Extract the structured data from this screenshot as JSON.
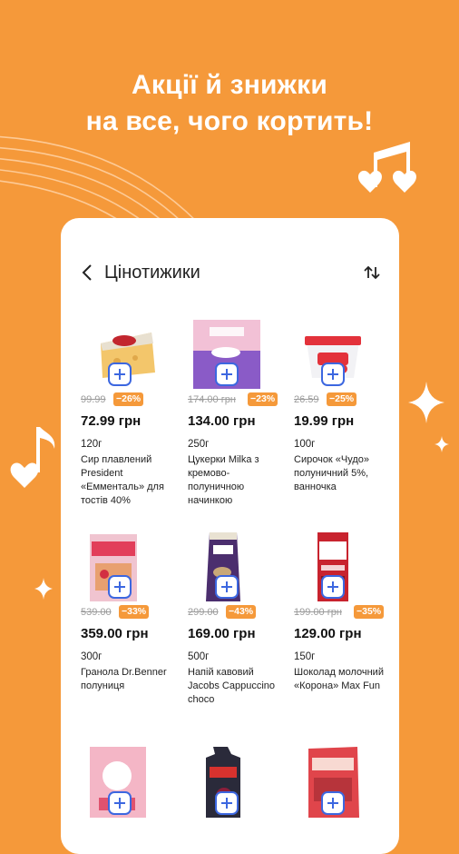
{
  "headline": {
    "line1": "Акції й знижки",
    "line2": "на все, чого кортить!"
  },
  "screen": {
    "title": "Цінотижики",
    "back_icon": "chevron-left-icon",
    "sort_icon": "sort-arrows-icon"
  },
  "colors": {
    "background": "#F5993A",
    "discount_badge": "#F5993A",
    "add_button": "#3C67E0"
  },
  "products": [
    {
      "old_price": "99.99",
      "discount": "−26%",
      "price": "72.99 грн",
      "weight": "120г",
      "name": "Сир плавлений President «Емменталь» для тостів 40%"
    },
    {
      "old_price": "174.00 грн",
      "discount": "−23%",
      "price": "134.00 грн",
      "weight": "250г",
      "name": "Цукерки Milka з кремово-полуничною начинкою"
    },
    {
      "old_price": "26.59",
      "discount": "−25%",
      "price": "19.99 грн",
      "weight": "100г",
      "name": "Сирочок «Чудо» полуничний 5%, ванночка"
    },
    {
      "old_price": "539.00",
      "discount": "−33%",
      "price": "359.00 грн",
      "weight": "300г",
      "name": "Гранола Dr.Benner полуниця"
    },
    {
      "old_price": "299.00",
      "discount": "−43%",
      "price": "169.00 грн",
      "weight": "500г",
      "name": "Напій кавовий Jacobs Cappuccino choco"
    },
    {
      "old_price": "199.00 грн",
      "discount": "−35%",
      "price": "129.00 грн",
      "weight": "150г",
      "name": "Шоколад молочний «Корона» Max Fun"
    },
    {
      "old_price": "",
      "discount": "",
      "price": "",
      "weight": "",
      "name": ""
    },
    {
      "old_price": "",
      "discount": "",
      "price": "",
      "weight": "",
      "name": ""
    },
    {
      "old_price": "",
      "discount": "",
      "price": "",
      "weight": "",
      "name": ""
    }
  ],
  "icons": {
    "music_notes": "music-notes-icon",
    "sparkle": "sparkle-icon",
    "add": "plus-icon"
  }
}
